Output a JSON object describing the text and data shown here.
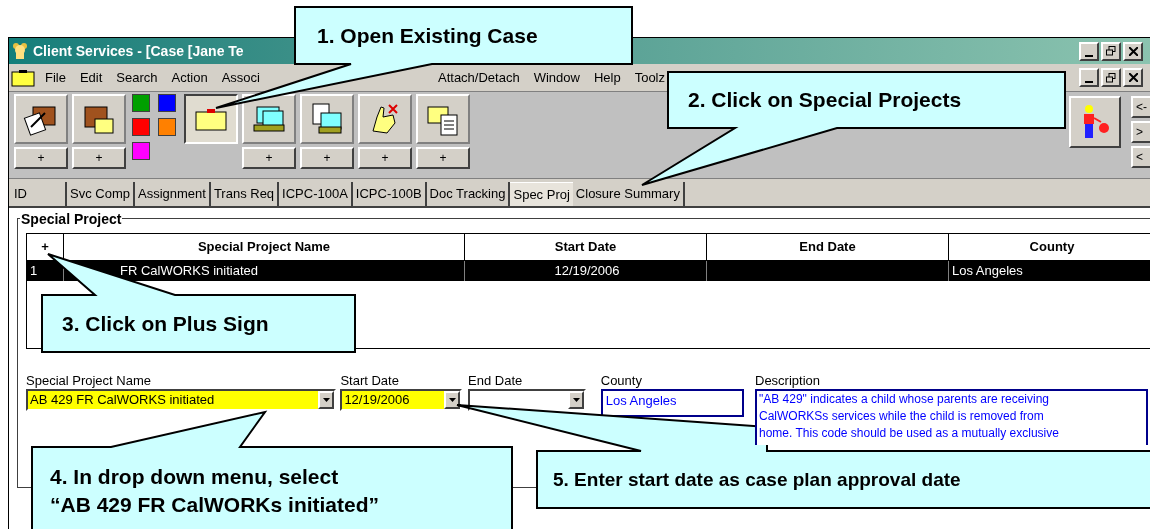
{
  "window": {
    "title": "Client Services - [Case [Jane Te"
  },
  "menu": [
    "File",
    "Edit",
    "Search",
    "Action",
    "Associ",
    "Attach/Detach",
    "Window",
    "Help",
    "Toolz"
  ],
  "toolbar": {
    "buttons": [
      {
        "kind": "notebook",
        "pressed": false,
        "plus": "+"
      },
      {
        "kind": "briefcase",
        "pressed": false,
        "plus": "+"
      },
      {
        "kind": "colors"
      },
      {
        "kind": "folder",
        "pressed": true
      },
      {
        "kind": "cards",
        "pressed": false,
        "plus": "+"
      },
      {
        "kind": "pages",
        "pressed": false,
        "plus": "+"
      },
      {
        "kind": "hand",
        "pressed": false,
        "plus": "+"
      },
      {
        "kind": "copy",
        "pressed": false,
        "plus": "+"
      }
    ],
    "colors": [
      {
        "color": "#00a000"
      },
      {
        "color": "#0000ff"
      },
      {
        "color": "#ff0000"
      },
      {
        "color": "#ff8000"
      },
      {
        "color": "#ff00ff"
      }
    ],
    "nav": [
      "<-",
      ">",
      "<"
    ]
  },
  "tabs": [
    {
      "label": "ID",
      "selected": false
    },
    {
      "label": "Svc Comp",
      "selected": false
    },
    {
      "label": "Assignment",
      "selected": false
    },
    {
      "label": "Trans Req",
      "selected": false
    },
    {
      "label": "ICPC-100A",
      "selected": false
    },
    {
      "label": "ICPC-100B",
      "selected": false
    },
    {
      "label": "Doc Tracking",
      "selected": false
    },
    {
      "label": "Spec Proj",
      "selected": true
    },
    {
      "label": "Closure Summary",
      "selected": false
    }
  ],
  "group": {
    "title": "Special Project"
  },
  "table": {
    "columns": [
      "+",
      "Special Project Name",
      "Start Date",
      "End Date",
      "County"
    ],
    "rows": [
      {
        "cells": [
          "1",
          "FR CalWORKS initiated",
          "12/19/2006",
          "",
          "Los Angeles"
        ],
        "selected": true
      }
    ]
  },
  "form": {
    "name": {
      "label": "Special Project Name",
      "value": "AB 429 FR CalWORKS initiated"
    },
    "start": {
      "label": "Start Date",
      "value": "12/19/2006"
    },
    "end": {
      "label": "End Date"
    },
    "county": {
      "label": "County",
      "value": "Los Angeles"
    },
    "description": {
      "label": "Description",
      "lines": [
        "\"AB 429\" indicates a child whose parents are receiving",
        "CalWORKSs services while the child is removed from",
        "home. This code should be used as a mutually exclusive"
      ]
    }
  },
  "callouts": [
    {
      "lines": [
        "1.  Open Existing Case"
      ]
    },
    {
      "lines": [
        "2. Click on Special Projects"
      ]
    },
    {
      "lines": [
        "3. Click on Plus Sign"
      ]
    },
    {
      "lines": [
        "4. In drop down menu, select",
        "“AB 429 FR CalWORKs initiated”"
      ]
    },
    {
      "lines": [
        "5. Enter start date as case plan approval date"
      ]
    }
  ]
}
